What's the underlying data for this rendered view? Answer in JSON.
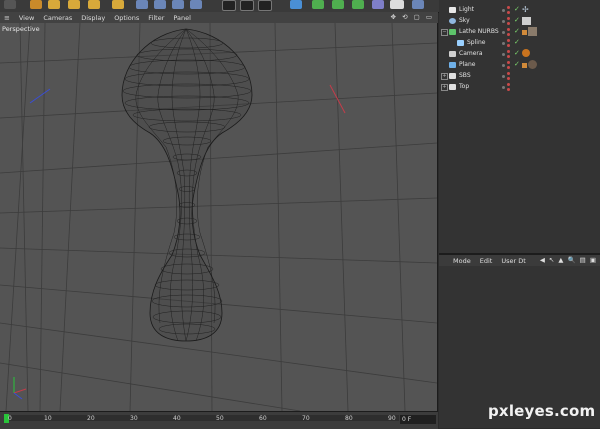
{
  "viewport": {
    "menu": [
      "View",
      "Cameras",
      "Display",
      "Options",
      "Filter",
      "Panel"
    ],
    "label": "Perspective",
    "header_icons": "✥ ⟲ ▢ ▭"
  },
  "objects": [
    {
      "name": "Light",
      "icon_color": "#e8e8e8",
      "expand": ""
    },
    {
      "name": "Sky",
      "icon_color": "#8fb7e0",
      "expand": ""
    },
    {
      "name": "Lathe NURBS",
      "icon_color": "#5ec46b",
      "expand": "−"
    },
    {
      "name": "Spline",
      "icon_color": "#9ad0ff",
      "expand": ""
    },
    {
      "name": "Camera",
      "icon_color": "#d0d0d0",
      "expand": ""
    },
    {
      "name": "Plane",
      "icon_color": "#6fb0e8",
      "expand": ""
    },
    {
      "name": "SBS",
      "icon_color": "#e0e0e0",
      "expand": "+"
    },
    {
      "name": "Top",
      "icon_color": "#e0e0e0",
      "expand": "+"
    }
  ],
  "attributes": {
    "menu": [
      "Mode",
      "Edit",
      "User Dt"
    ],
    "tools": "◀ ↖ ▲ 🔍 ▤ ▣"
  },
  "timeline": {
    "ticks": [
      "0",
      "10",
      "20",
      "30",
      "40",
      "50",
      "60",
      "70",
      "80",
      "90"
    ],
    "frame_field": "0 F"
  },
  "watermark": "pxleyes.com",
  "colors": {
    "viewport_bg": "#545454",
    "panel_bg": "#333333",
    "timeline_marker": "#29c43a"
  }
}
